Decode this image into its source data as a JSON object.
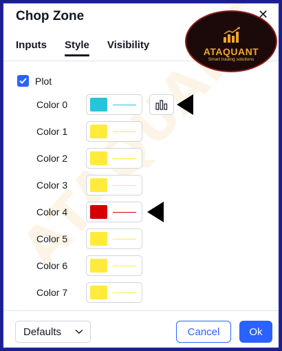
{
  "dialog": {
    "title": "Chop Zone",
    "close_glyph": "✕"
  },
  "tabs": [
    {
      "label": "Inputs",
      "active": false
    },
    {
      "label": "Style",
      "active": true
    },
    {
      "label": "Visibility",
      "active": false
    }
  ],
  "logo": {
    "name": "ATAQUANT",
    "tagline": "Smart trading solutions"
  },
  "watermark": "ATAQUANT",
  "plot": {
    "label": "Plot",
    "checked": true
  },
  "colors": [
    {
      "label": "Color 0",
      "swatch": "#26c6da"
    },
    {
      "label": "Color 1",
      "swatch": "#ffeb3b"
    },
    {
      "label": "Color 2",
      "swatch": "#ffeb3b"
    },
    {
      "label": "Color 3",
      "swatch": "#ffeb3b"
    },
    {
      "label": "Color 4",
      "swatch": "#d50000"
    },
    {
      "label": "Color 5",
      "swatch": "#ffeb3b"
    },
    {
      "label": "Color 6",
      "swatch": "#ffeb3b"
    },
    {
      "label": "Color 7",
      "swatch": "#ffeb3b"
    }
  ],
  "footer": {
    "defaults_label": "Defaults",
    "cancel_label": "Cancel",
    "ok_label": "Ok"
  },
  "theme": {
    "accent": "#2962ff",
    "frame": "#1a1f8c"
  }
}
